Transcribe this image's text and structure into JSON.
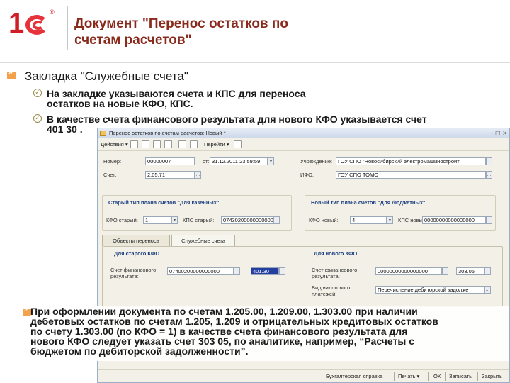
{
  "slide": {
    "title_line1": "Документ \"Перенос остатков по",
    "title_line2": "счетам расчетов\"",
    "bullet_main": "Закладка \"Служебные счета\"",
    "sub1_line1": "На закладке указываются счета и КПС для переноса",
    "sub1_line2": "остатков на новые КФО, КПС.",
    "sub2_line1": "В качестве счета финансового результата для нового КФО указывается счет",
    "sub2_line2": "401 30 .",
    "bottom_line1": "При оформлении документа по счетам 1.205.00, 1.209.00, 1.303.00 при наличии",
    "bottom_line2": "дебетовых остатков по счетам 1.205, 1.209 и отрицательных кредитовых остатков",
    "bottom_line3": "по счету 1.303.00 (по КФО = 1) в качестве счета финансового результата для",
    "bottom_line4": "нового КФО следует указать счет 303 05, по аналитике, например, “Расчеты с",
    "bottom_line5": "бюджетом по дебиторской задолженности”."
  },
  "window": {
    "title": "Перенос остатков по счетам расчетов: Новый *",
    "toolbar": {
      "actions": "Действия",
      "goto": "Перейти"
    },
    "header": {
      "number_label": "Номер:",
      "number_value": "00000007",
      "from_label": "от:",
      "date_value": "31.12.2011 23:59:59",
      "institution_label": "Учреждение:",
      "institution_value": "ГОУ СПО \"Новосибирский электромашиностроит",
      "account_label": "Счет:",
      "account_value": "2.05.71",
      "ifo_label": "ИФО:",
      "ifo_value": "ГОУ СПО ТОМО"
    },
    "old_plan": {
      "header": "Старый тип плана счетов \"Для казенных\"",
      "kfo_label": "КФО старый:",
      "kfo_value": "1",
      "kps_label": "КПС старый:",
      "kps_value": "07430200000000000"
    },
    "new_plan": {
      "header": "Новый тип плана счетов \"Для бюджетных\"",
      "kfo_label": "КФО новый:",
      "kfo_value": "4",
      "kps_label": "КПС новый:",
      "kps_value": "00000000000000000"
    },
    "tabs": {
      "tab1": "Объекты переноса",
      "tab2": "Служебные счета"
    },
    "old_kfo": {
      "header": "Для старого КФО",
      "result_label_1": "Счет финансового",
      "result_label_2": "результата:",
      "kps_value": "07400200000000000",
      "account_value": "401.30"
    },
    "new_kfo": {
      "header": "Для нового КФО",
      "result_label_1": "Счет финансового",
      "result_label_2": "результата:",
      "kps_value": "00000000000000000",
      "account_value": "303.05",
      "payment_label_1": "Вид налогового",
      "payment_label_2": "платежей:",
      "payment_value": "Перечисление дебиторской задолже"
    },
    "bottombar": {
      "print_form": "Бухгалтерская справка",
      "print": "Печать",
      "ok": "OK",
      "save": "Записать",
      "close": "Закрыть"
    }
  }
}
